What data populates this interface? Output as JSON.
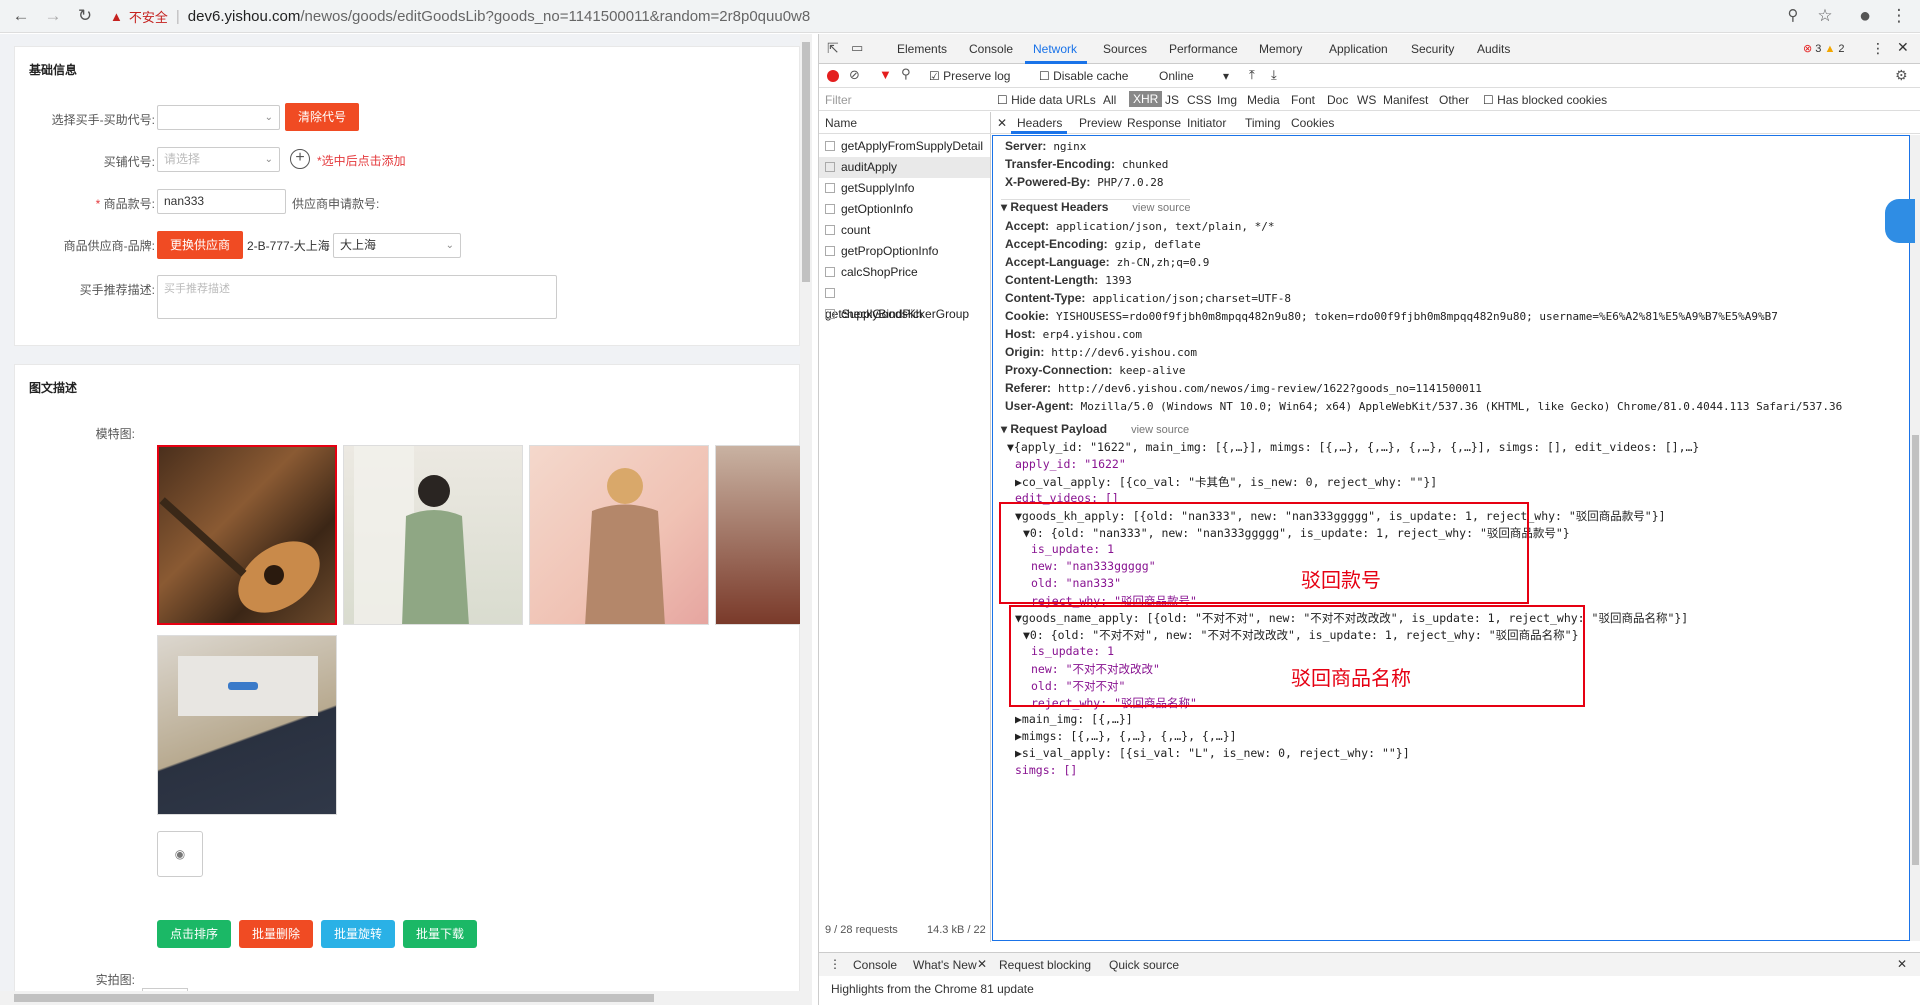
{
  "browser": {
    "insecure_label": "不安全",
    "url_host": "dev6.yishou.com",
    "url_path": "/newos/goods/editGoodsLib?goods_no=1141500011&random=2r8p0quu0w8"
  },
  "basic": {
    "title": "基础信息",
    "buyer_label": "选择买手-买助代号:",
    "clear_code_button": "清除代号",
    "shop_code_label": "买铺代号:",
    "shop_code_placeholder": "请选择",
    "add_hint": "*选中后点击添加",
    "goods_no_label": "商品款号:",
    "goods_no_value": "nan333",
    "supplier_no_label": "供应商申请款号:",
    "supplier_brand_label": "商品供应商-品牌:",
    "change_supplier_button": "更换供应商",
    "supplier_value": "2-B-777-大上海",
    "brand_value": "大上海",
    "recommend_label": "买手推荐描述:",
    "recommend_placeholder": "买手推荐描述"
  },
  "images": {
    "title": "图文描述",
    "model_label": "模特图:",
    "buttons": [
      "点击排序",
      "批量删除",
      "批量旋转",
      "批量下载"
    ],
    "real_label": "实拍图:"
  },
  "devtools": {
    "tabs": [
      "Elements",
      "Console",
      "Network",
      "Sources",
      "Performance",
      "Memory",
      "Application",
      "Security",
      "Audits"
    ],
    "errors": "3",
    "warnings": "2",
    "preserve_log": "Preserve log",
    "disable_cache": "Disable cache",
    "throttle": "Online",
    "filter_placeholder": "Filter",
    "hide_data_urls": "Hide data URLs",
    "filter_types": [
      "All",
      "XHR",
      "JS",
      "CSS",
      "Img",
      "Media",
      "Font",
      "Doc",
      "WS",
      "Manifest",
      "Other"
    ],
    "has_blocked": "Has blocked cookies",
    "name_header": "Name",
    "requests": [
      "getApplyFromSupplyDetail",
      "auditApply",
      "getSupplyInfo",
      "getOptionInfo",
      "count",
      "getPropOptionInfo",
      "calcShopPrice",
      "getSupplyBindPickerGroup",
      "checkGoodsKh"
    ],
    "detail_tabs": [
      "Headers",
      "Preview",
      "Response",
      "Initiator",
      "Timing",
      "Cookies"
    ],
    "status_bar": "9 / 28 requests",
    "status_size": "14.3 kB / 22",
    "response_headers": [
      {
        "k": "Server:",
        "v": "nginx"
      },
      {
        "k": "Transfer-Encoding:",
        "v": "chunked"
      },
      {
        "k": "X-Powered-By:",
        "v": "PHP/7.0.28"
      }
    ],
    "request_headers_title": "Request Headers",
    "view_source": "view source",
    "request_headers": [
      {
        "k": "Accept:",
        "v": "application/json, text/plain, */*"
      },
      {
        "k": "Accept-Encoding:",
        "v": "gzip, deflate"
      },
      {
        "k": "Accept-Language:",
        "v": "zh-CN,zh;q=0.9"
      },
      {
        "k": "Content-Length:",
        "v": "1393"
      },
      {
        "k": "Content-Type:",
        "v": "application/json;charset=UTF-8"
      },
      {
        "k": "Cookie:",
        "v": "YISHOUSESS=rdo00f9fjbh0m8mpqq482n9u80; token=rdo00f9fjbh0m8mpqq482n9u80; username=%E6%A2%81%E5%A9%B7%E5%A9%B7"
      },
      {
        "k": "Host:",
        "v": "erp4.yishou.com"
      },
      {
        "k": "Origin:",
        "v": "http://dev6.yishou.com"
      },
      {
        "k": "Proxy-Connection:",
        "v": "keep-alive"
      },
      {
        "k": "Referer:",
        "v": "http://dev6.yishou.com/newos/img-review/1622?goods_no=1141500011"
      },
      {
        "k": "User-Agent:",
        "v": "Mozilla/5.0 (Windows NT 10.0; Win64; x64) AppleWebKit/537.36 (KHTML, like Gecko) Chrome/81.0.4044.113 Safari/537.36"
      }
    ],
    "payload_title": "Request Payload",
    "payload": [
      "▼{apply_id: \"1622\", main_img: [{,…}], mimgs: [{,…}, {,…}, {,…}, {,…}], simgs: [], edit_videos: [],…}",
      "apply_id: \"1622\"",
      "▶co_val_apply: [{co_val: \"卡其色\", is_new: 0, reject_why: \"\"}]",
      "edit_videos: []",
      "▼goods_kh_apply: [{old: \"nan333\", new: \"nan333ggggg\", is_update: 1, reject_why: \"驳回商品款号\"}]",
      "▼0: {old: \"nan333\", new: \"nan333ggggg\", is_update: 1, reject_why: \"驳回商品款号\"}",
      "is_update: 1",
      "new: \"nan333ggggg\"",
      "old: \"nan333\"",
      "reject_why: \"驳回商品款号\"",
      "▼goods_name_apply: [{old: \"不对不对\", new: \"不对不对改改改\", is_update: 1, reject_why: \"驳回商品名称\"}]",
      "▼0: {old: \"不对不对\", new: \"不对不对改改改\", is_update: 1, reject_why: \"驳回商品名称\"}",
      "is_update: 1",
      "new: \"不对不对改改改\"",
      "old: \"不对不对\"",
      "reject_why: \"驳回商品名称\"",
      "▶main_img: [{,…}]",
      "▶mimgs: [{,…}, {,…}, {,…}, {,…}]",
      "▶si_val_apply: [{si_val: \"L\", is_new: 0, reject_why: \"\"}]",
      "simgs: []"
    ],
    "annotation_kh": "驳回款号",
    "annotation_name": "驳回商品名称",
    "drawer_tabs": [
      "Console",
      "What's New",
      "Request blocking",
      "Quick source"
    ],
    "drawer_text": "Highlights from the Chrome 81 update"
  }
}
